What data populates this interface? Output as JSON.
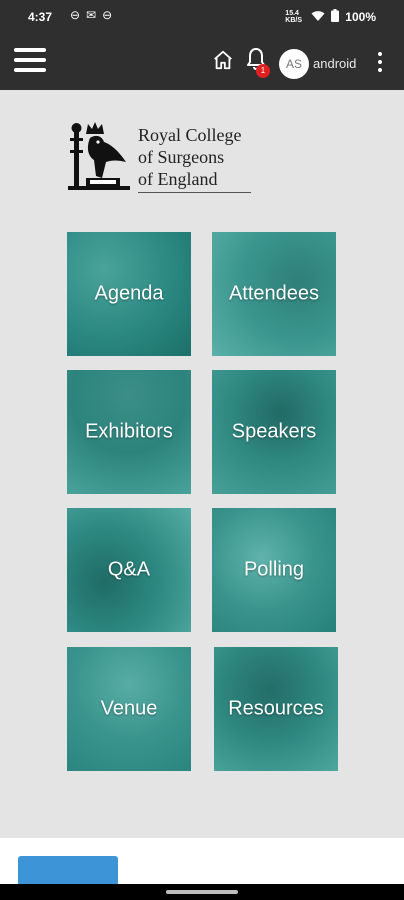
{
  "status_bar": {
    "time": "4:37",
    "left_icons": [
      "sim-icon",
      "mail-icon",
      "sim-icon"
    ],
    "speed": "15.4 KB/S",
    "battery": "100%"
  },
  "app_bar": {
    "notification_count": "1",
    "avatar_initials": "AS",
    "username": "android"
  },
  "logo": {
    "lines": [
      "Royal College",
      "of Surgeons",
      "of England"
    ]
  },
  "tiles": [
    {
      "label": "Agenda"
    },
    {
      "label": "Attendees"
    },
    {
      "label": "Exhibitors"
    },
    {
      "label": "Speakers"
    },
    {
      "label": "Q&A"
    },
    {
      "label": "Polling"
    },
    {
      "label": "Venue"
    },
    {
      "label": "Resources"
    }
  ],
  "colors": {
    "app_bar": "#2f2f2f",
    "tile_teal": "#2b8d86",
    "page_bg": "#e4e4e4",
    "notification_badge": "#e02020"
  }
}
